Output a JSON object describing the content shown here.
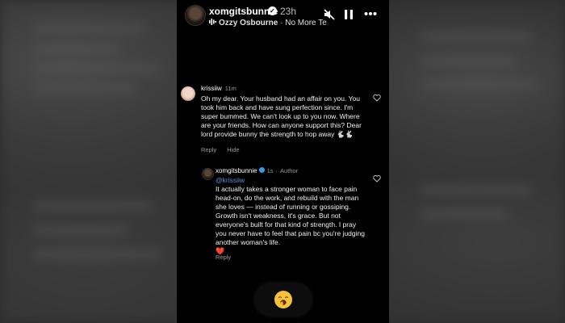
{
  "story": {
    "username": "xomgitsbunnie",
    "time": "23h",
    "music": {
      "artist": "Ozzy Osbourne",
      "separator": " · ",
      "title": "No More Te"
    },
    "icons": [
      "music-bars-icon",
      "mute-icon",
      "pause-icon",
      "more-icon"
    ]
  },
  "comment": {
    "username": "krissiiw",
    "time": "11m",
    "text": "Oh my dear. Your husband had an affair on you. You took him back and have sung perfection since. I'm super bummed. We can't look up to you now. Where are your friends. How can anyone support this? Dear lord provide bunny the strength to hop away 🐇🐇",
    "actions": {
      "reply": "Reply",
      "hide": "Hide"
    }
  },
  "reply": {
    "username": "xomgitsbunnie",
    "time": "1s",
    "role": "Author",
    "mention": "@krissiiw",
    "text": "It actually takes a stronger woman to face pain head-on, do the work, and rebuild with the man she loves — instead of running or gossiping. Growth isn't weakness, it's grace. But not everyone's built for that kind of strength. I pray you never have to feel that pain bc you're judging another woman's life.",
    "emoji": "❤️",
    "action": "Reply"
  },
  "reaction": {
    "emoji": "🥱",
    "icon": "yawning-face-icon"
  },
  "colors": {
    "mention": "#5c8fd6",
    "verified": "#3897f0",
    "background": "#000000"
  }
}
